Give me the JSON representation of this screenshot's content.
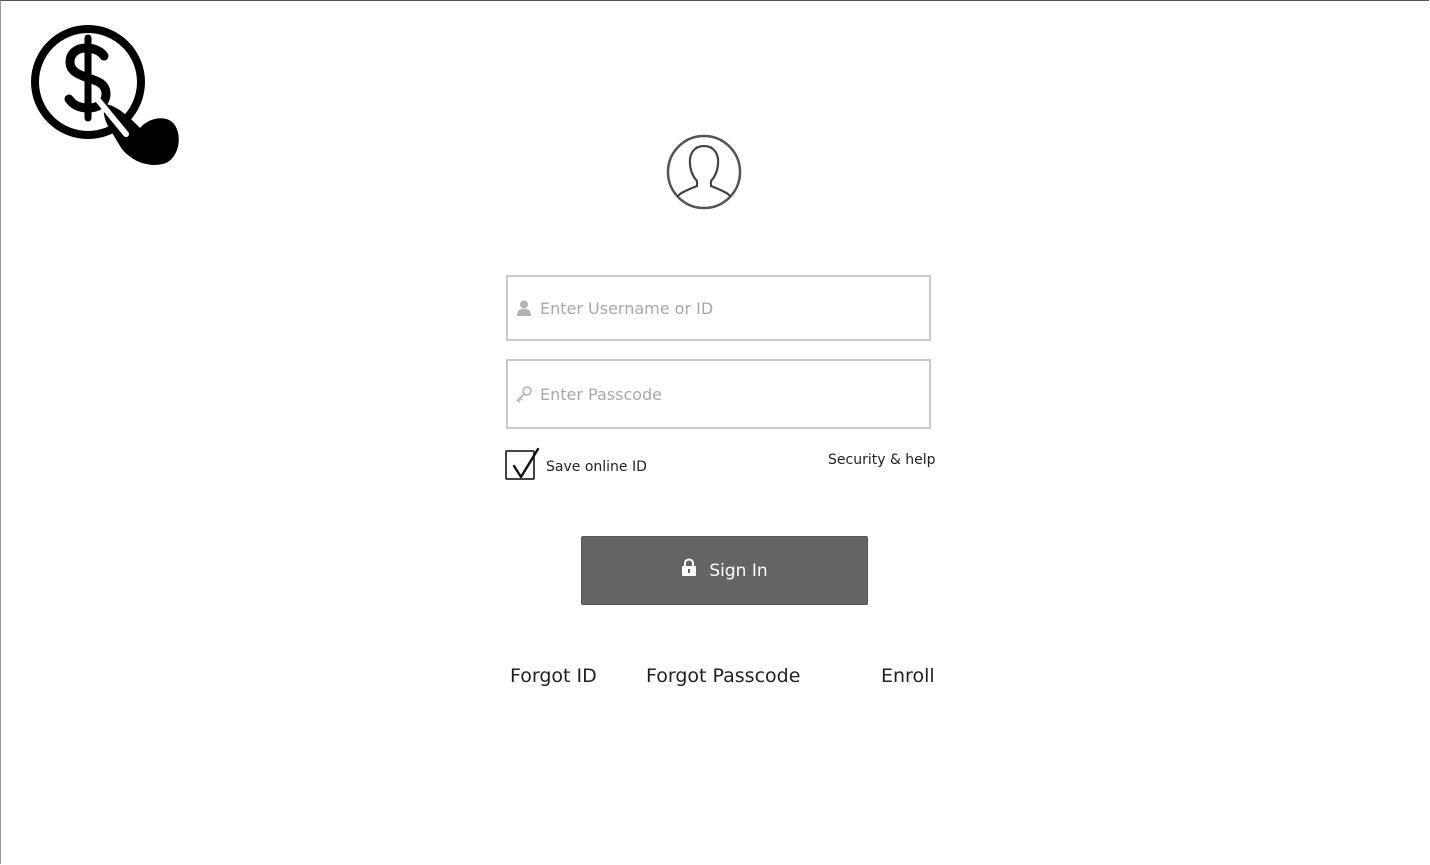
{
  "login": {
    "username_placeholder": "Enter Username or ID",
    "passcode_placeholder": "Enter Passcode",
    "save_label": "Save online ID",
    "save_checked": true,
    "security_help": "Security & help",
    "signin_label": "Sign In"
  },
  "links": {
    "forgot_id": "Forgot ID",
    "forgot_passcode": "Forgot Passcode",
    "enroll": "Enroll"
  },
  "icons": {
    "logo": "dollar-coin-tap-icon",
    "avatar": "user-avatar-icon",
    "username": "user-icon",
    "passcode": "key-icon",
    "signin": "lock-icon",
    "checkbox": "checkmark-icon"
  },
  "colors": {
    "button": "#646464",
    "placeholder": "#a8a8a8",
    "text": "#222222"
  }
}
